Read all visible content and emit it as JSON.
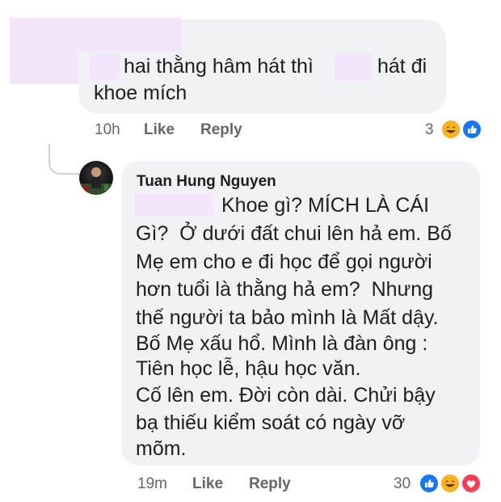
{
  "comment1": {
    "text_line1": "hai thằng hâm hát thì",
    "text_line1b": "hát đi",
    "text_line2": "khoe mích",
    "time": "10h",
    "like": "Like",
    "reply": "Reply",
    "reactions_count": "3",
    "reactions": [
      "haha-icon",
      "like-icon"
    ]
  },
  "reply1": {
    "author": "Tuan Hung Nguyen",
    "lines": [
      "Khoe gì? MÍCH LÀ CÁI",
      "Gì?  Ở dưới đất chui lên hả em. Bố",
      "Mẹ em cho e đi học để gọi người",
      "hơn tuổi là thằng hả em?  Nhưng",
      "thế người ta bảo mình là Mất dậy.",
      "Bố Mẹ xấu hổ. Mình là đàn ông :",
      "Tiên học lễ, hậu học văn.",
      "Cố lên em. Đời còn dài. Chửi bậy",
      "bạ thiếu kiểm soát có ngày vỡ",
      "mõm."
    ],
    "time": "19m",
    "like": "Like",
    "reply": "Reply",
    "reactions_count": "30",
    "reactions": [
      "like-icon",
      "haha-icon",
      "love-icon"
    ]
  },
  "colors": {
    "bubble": "#f0f2f5",
    "censor": "#f3e6fb",
    "meta": "#65676b",
    "like_blue": "#1877f2",
    "haha_yellow": "#f7b125",
    "love_red": "#f33e58"
  }
}
